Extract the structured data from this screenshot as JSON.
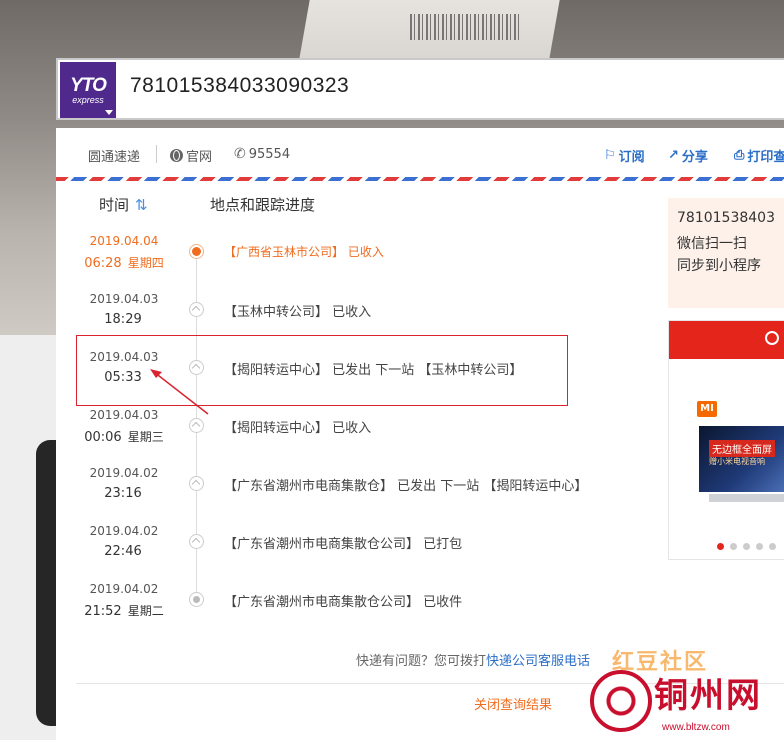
{
  "tracking_number": "781015384033090323",
  "logo": {
    "mark": "YTO",
    "sub": "express"
  },
  "infobar": {
    "company": "圆通速递",
    "website": "官网",
    "phone": "95554",
    "subscribe": "订阅",
    "share": "分享",
    "print": "打印查"
  },
  "timeline": {
    "col_time": "时间",
    "col_progress": "地点和跟踪进度",
    "events": [
      {
        "date": "2019.04.04",
        "time": "06:28",
        "weekday": "星期四",
        "desc": "【广西省玉林市公司】 已收入"
      },
      {
        "date": "2019.04.03",
        "time": "18:29",
        "weekday": "",
        "desc": "【玉林中转公司】 已收入"
      },
      {
        "date": "2019.04.03",
        "time": "05:33",
        "weekday": "",
        "desc": "【揭阳转运中心】 已发出 下一站 【玉林中转公司】"
      },
      {
        "date": "2019.04.03",
        "time": "00:06",
        "weekday": "星期三",
        "desc": "【揭阳转运中心】 已收入"
      },
      {
        "date": "2019.04.02",
        "time": "23:16",
        "weekday": "",
        "desc": "【广东省潮州市电商集散仓】 已发出 下一站 【揭阳转运中心】"
      },
      {
        "date": "2019.04.02",
        "time": "22:46",
        "weekday": "",
        "desc": "【广东省潮州市电商集散仓公司】 已打包"
      },
      {
        "date": "2019.04.02",
        "time": "21:52",
        "weekday": "星期二",
        "desc": "【广东省潮州市电商集散仓公司】 已收件"
      }
    ]
  },
  "footer": {
    "question": "快递有问题？您可拨打",
    "link": "快递公司客服电话",
    "close": "关闭查询结果"
  },
  "miniprogram": {
    "number": "78101538403",
    "line1": "微信扫一扫",
    "line2": "同步到小程序"
  },
  "ad": {
    "brand": "MI",
    "headline": "无边框全面屏",
    "sub": "赠小米电视音响"
  },
  "watermark": {
    "top": "红豆社区",
    "big": "铜州网",
    "url": "www.bltzw.com"
  },
  "colors": {
    "accent_orange": "#f06c1e",
    "link_blue": "#2b6fc7",
    "highlight_red": "#d9232e",
    "yto_purple": "#4f2a8c"
  }
}
